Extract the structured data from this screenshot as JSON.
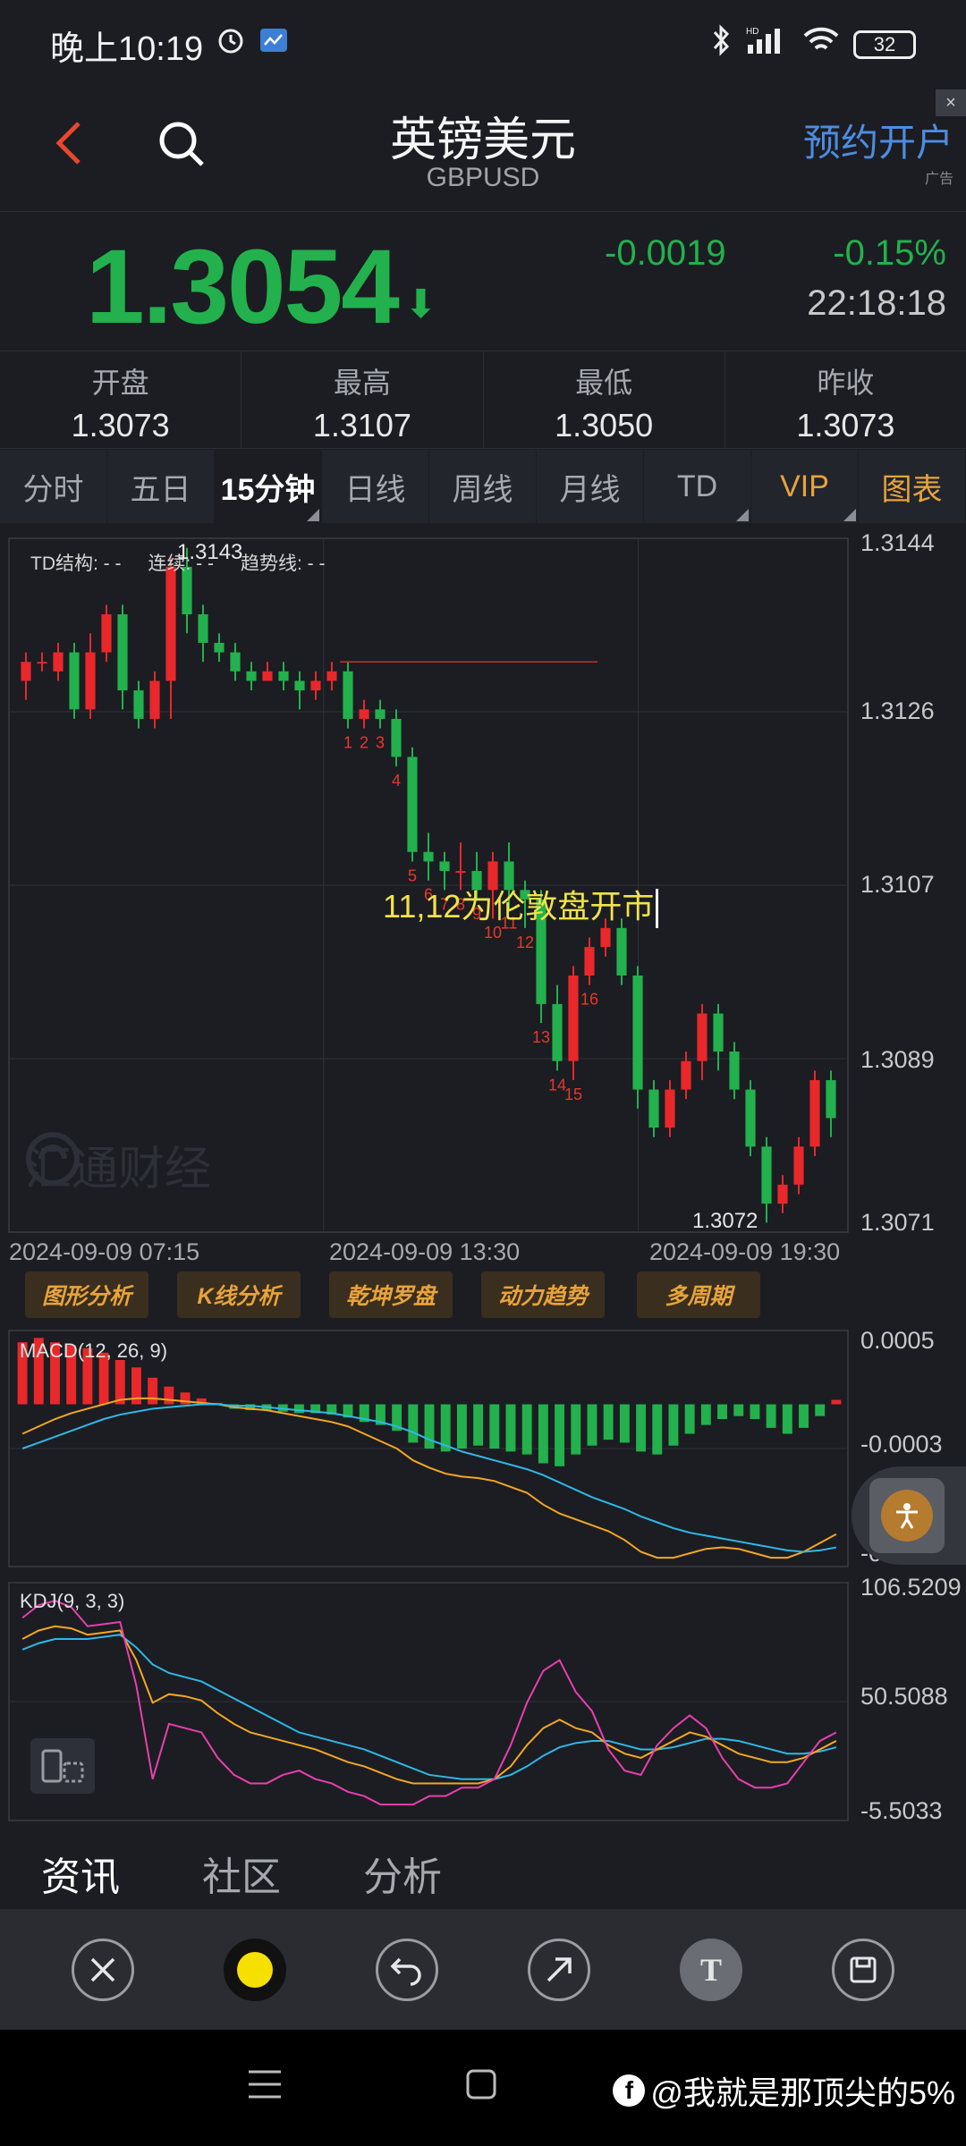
{
  "status_bar": {
    "time": "晚上10:19",
    "battery": "32",
    "network": "HD"
  },
  "header": {
    "title": "英镑美元",
    "subtitle": "GBPUSD",
    "open_account": "预约开户",
    "ad_label": "广告",
    "ad_close": "×"
  },
  "quote": {
    "price": "1.3054",
    "arrow": "⬇",
    "change": "-0.0019",
    "change_pct": "-0.15%",
    "time": "22:18:18",
    "color_down": "#22b14c"
  },
  "ohlc": [
    {
      "label": "开盘",
      "value": "1.3073"
    },
    {
      "label": "最高",
      "value": "1.3107"
    },
    {
      "label": "最低",
      "value": "1.3050"
    },
    {
      "label": "昨收",
      "value": "1.3073"
    }
  ],
  "tabs": [
    "分时",
    "五日",
    "15分钟",
    "日线",
    "周线",
    "月线",
    "TD",
    "VIP",
    "图表"
  ],
  "active_tab": "15分钟",
  "td_info": {
    "structure": "TD结构: - -",
    "continuous": "连续: - -",
    "trend": "趋势线: - -"
  },
  "annotation": "11,12为伦敦盘开市",
  "watermark": "汇通财经",
  "tools": [
    "图形分析",
    "K线分析",
    "乾坤罗盘",
    "动力趋势",
    "多周期"
  ],
  "news_tabs": [
    "资讯",
    "社区",
    "分析"
  ],
  "credit": "@我就是那顶尖的5%",
  "chart_data": [
    {
      "type": "candlestick",
      "title": "",
      "y_axis_labels": [
        "1.3144",
        "1.3126",
        "1.3107",
        "1.3089",
        "1.3071"
      ],
      "ylim": [
        1.3071,
        1.3144
      ],
      "x_axis_labels": [
        "2024-09-09 07:15",
        "2024-09-09 13:30",
        "2024-09-09 19:30"
      ],
      "high_label": "1.3143",
      "low_label": "1.3072",
      "horizontal_line": 1.3131,
      "td_counts": [
        "1",
        "2",
        "3",
        "4",
        "5",
        "6",
        "7",
        "8",
        "9",
        "10",
        "11",
        "12",
        "13",
        "14",
        "15",
        "16"
      ],
      "colors": {
        "up": "#e8282a",
        "down": "#22b14c"
      },
      "candles": [
        [
          1.3129,
          1.3131,
          1.3127,
          1.3132
        ],
        [
          1.3131,
          1.3131,
          1.313,
          1.3132
        ],
        [
          1.313,
          1.3132,
          1.3129,
          1.3133
        ],
        [
          1.3132,
          1.3126,
          1.3125,
          1.3133
        ],
        [
          1.3126,
          1.3132,
          1.3125,
          1.3134
        ],
        [
          1.3132,
          1.3136,
          1.3131,
          1.3137
        ],
        [
          1.3136,
          1.3128,
          1.3126,
          1.3137
        ],
        [
          1.3128,
          1.3125,
          1.3124,
          1.3129
        ],
        [
          1.3125,
          1.3129,
          1.3124,
          1.313
        ],
        [
          1.3129,
          1.3141,
          1.3125,
          1.3142
        ],
        [
          1.3141,
          1.3136,
          1.3134,
          1.3143
        ],
        [
          1.3136,
          1.3133,
          1.3131,
          1.3137
        ],
        [
          1.3133,
          1.3132,
          1.3131,
          1.3134
        ],
        [
          1.3132,
          1.313,
          1.3129,
          1.3133
        ],
        [
          1.313,
          1.3129,
          1.3128,
          1.3131
        ],
        [
          1.3129,
          1.313,
          1.3129,
          1.3131
        ],
        [
          1.313,
          1.3129,
          1.3128,
          1.3131
        ],
        [
          1.3129,
          1.3128,
          1.3126,
          1.313
        ],
        [
          1.3128,
          1.3129,
          1.3127,
          1.313
        ],
        [
          1.3129,
          1.313,
          1.3128,
          1.3131
        ],
        [
          1.313,
          1.3125,
          1.3124,
          1.3131
        ],
        [
          1.3125,
          1.3126,
          1.3124,
          1.3127
        ],
        [
          1.3126,
          1.3125,
          1.3124,
          1.3127
        ],
        [
          1.3125,
          1.3121,
          1.312,
          1.3126
        ],
        [
          1.3121,
          1.3111,
          1.311,
          1.3122
        ],
        [
          1.3111,
          1.311,
          1.3108,
          1.3113
        ],
        [
          1.311,
          1.3109,
          1.3107,
          1.3111
        ],
        [
          1.3109,
          1.3109,
          1.3107,
          1.3112
        ],
        [
          1.3109,
          1.3107,
          1.3106,
          1.3111
        ],
        [
          1.3107,
          1.311,
          1.3104,
          1.3111
        ],
        [
          1.311,
          1.3107,
          1.3105,
          1.3112
        ],
        [
          1.3107,
          1.3106,
          1.3103,
          1.3108
        ],
        [
          1.3106,
          1.3095,
          1.3093,
          1.3107
        ],
        [
          1.3095,
          1.3089,
          1.3088,
          1.3097
        ],
        [
          1.3089,
          1.3098,
          1.3087,
          1.3099
        ],
        [
          1.3098,
          1.3101,
          1.3097,
          1.3102
        ],
        [
          1.3101,
          1.3103,
          1.31,
          1.3104
        ],
        [
          1.3103,
          1.3098,
          1.3097,
          1.3104
        ],
        [
          1.3098,
          1.3086,
          1.3084,
          1.3099
        ],
        [
          1.3086,
          1.3082,
          1.3081,
          1.3087
        ],
        [
          1.3082,
          1.3086,
          1.3081,
          1.3087
        ],
        [
          1.3086,
          1.3089,
          1.3085,
          1.309
        ],
        [
          1.3089,
          1.3094,
          1.3087,
          1.3095
        ],
        [
          1.3094,
          1.309,
          1.3088,
          1.3095
        ],
        [
          1.309,
          1.3086,
          1.3085,
          1.3091
        ],
        [
          1.3086,
          1.308,
          1.3079,
          1.3087
        ],
        [
          1.308,
          1.3074,
          1.3072,
          1.3081
        ],
        [
          1.3074,
          1.3076,
          1.3073,
          1.3077
        ],
        [
          1.3076,
          1.308,
          1.3075,
          1.3081
        ],
        [
          1.308,
          1.3087,
          1.3079,
          1.3088
        ],
        [
          1.3087,
          1.3083,
          1.3081,
          1.3088
        ]
      ]
    },
    {
      "type": "bar+line",
      "title": "MACD(12, 26, 9)",
      "y_axis_labels": [
        "0.0005",
        "-0.0003",
        "-0.0011"
      ],
      "ylim": [
        -0.0011,
        0.0005
      ],
      "histogram": [
        0.00042,
        0.00045,
        0.00042,
        0.0004,
        0.00038,
        0.00035,
        0.0003,
        0.00025,
        0.00018,
        0.00012,
        8e-05,
        4e-05,
        1e-05,
        -3e-05,
        -4e-05,
        -4e-05,
        -5e-05,
        -6e-05,
        -6e-05,
        -7e-05,
        -9e-05,
        -0.00012,
        -0.00014,
        -0.00018,
        -0.00026,
        -0.0003,
        -0.00032,
        -0.0003,
        -0.00028,
        -0.0003,
        -0.00032,
        -0.00034,
        -0.0004,
        -0.00042,
        -0.00034,
        -0.00028,
        -0.00024,
        -0.00026,
        -0.00032,
        -0.00034,
        -0.00028,
        -0.0002,
        -0.00014,
        -0.0001,
        -8e-05,
        -0.0001,
        -0.00016,
        -0.0002,
        -0.00016,
        -8e-05,
        3e-05
      ],
      "dif": [
        -0.0002,
        -0.00015,
        -0.0001,
        -6e-05,
        -3e-05,
        0.0,
        3e-05,
        4e-05,
        4e-05,
        3e-05,
        2e-05,
        1e-05,
        0.0,
        -2e-05,
        -3e-05,
        -4e-05,
        -6e-05,
        -8e-05,
        -0.0001,
        -0.00012,
        -0.00015,
        -0.0002,
        -0.00025,
        -0.0003,
        -0.00038,
        -0.00043,
        -0.00047,
        -0.00049,
        -0.0005,
        -0.00052,
        -0.00056,
        -0.0006,
        -0.00068,
        -0.00074,
        -0.00078,
        -0.00082,
        -0.00086,
        -0.00092,
        -0.001,
        -0.00104,
        -0.00104,
        -0.00101,
        -0.00098,
        -0.00097,
        -0.00098,
        -0.00101,
        -0.00104,
        -0.00104,
        -0.001,
        -0.00094,
        -0.00088
      ],
      "dea": [
        -0.0003,
        -0.00026,
        -0.00022,
        -0.00018,
        -0.00014,
        -0.0001,
        -7e-05,
        -5e-05,
        -3e-05,
        -2e-05,
        -1e-05,
        0.0,
        0.0,
        -1e-05,
        -1e-05,
        -2e-05,
        -3e-05,
        -4e-05,
        -5e-05,
        -6e-05,
        -8e-05,
        -0.0001,
        -0.00012,
        -0.00015,
        -0.00019,
        -0.00024,
        -0.00028,
        -0.00032,
        -0.00035,
        -0.00038,
        -0.00041,
        -0.00044,
        -0.00048,
        -0.00053,
        -0.00058,
        -0.00063,
        -0.00067,
        -0.00071,
        -0.00076,
        -0.0008,
        -0.00084,
        -0.00087,
        -0.00089,
        -0.00091,
        -0.00093,
        -0.00095,
        -0.00097,
        -0.00099,
        -0.001,
        -0.00099,
        -0.00097
      ],
      "colors": {
        "dif": "#f5a623",
        "dea": "#2fb8e8",
        "pos": "#e8282a",
        "neg": "#22b14c"
      }
    },
    {
      "type": "line",
      "title": "KDJ(9, 3, 3)",
      "y_axis_labels": [
        "106.5209",
        "50.5088",
        "-5.5033"
      ],
      "ylim": [
        -5.5033,
        106.5209
      ],
      "k": [
        80,
        84,
        86,
        85,
        82,
        83,
        84,
        70,
        50,
        54,
        53,
        51,
        45,
        40,
        36,
        34,
        32,
        30,
        28,
        25,
        22,
        20,
        17,
        14,
        12,
        12,
        12,
        12,
        12,
        14,
        20,
        30,
        38,
        42,
        38,
        36,
        30,
        26,
        24,
        28,
        32,
        36,
        34,
        30,
        26,
        24,
        22,
        22,
        24,
        28,
        32
      ],
      "d": [
        75,
        78,
        80,
        80,
        80,
        81,
        82,
        76,
        68,
        64,
        62,
        60,
        56,
        52,
        48,
        44,
        40,
        36,
        34,
        32,
        30,
        28,
        25,
        22,
        19,
        16,
        15,
        14,
        14,
        14,
        16,
        20,
        25,
        29,
        31,
        32,
        32,
        30,
        28,
        28,
        29,
        31,
        33,
        33,
        32,
        30,
        28,
        26,
        26,
        27,
        29
      ],
      "j": [
        90,
        96,
        98,
        95,
        86,
        87,
        88,
        58,
        14,
        40,
        38,
        36,
        24,
        16,
        12,
        12,
        16,
        18,
        14,
        12,
        8,
        6,
        2,
        2,
        2,
        6,
        6,
        10,
        10,
        14,
        30,
        50,
        65,
        70,
        55,
        46,
        28,
        18,
        16,
        30,
        38,
        44,
        38,
        24,
        14,
        10,
        10,
        12,
        22,
        32,
        36
      ],
      "colors": {
        "k": "#f5a623",
        "d": "#2fb8e8",
        "j": "#e83fae"
      }
    }
  ]
}
